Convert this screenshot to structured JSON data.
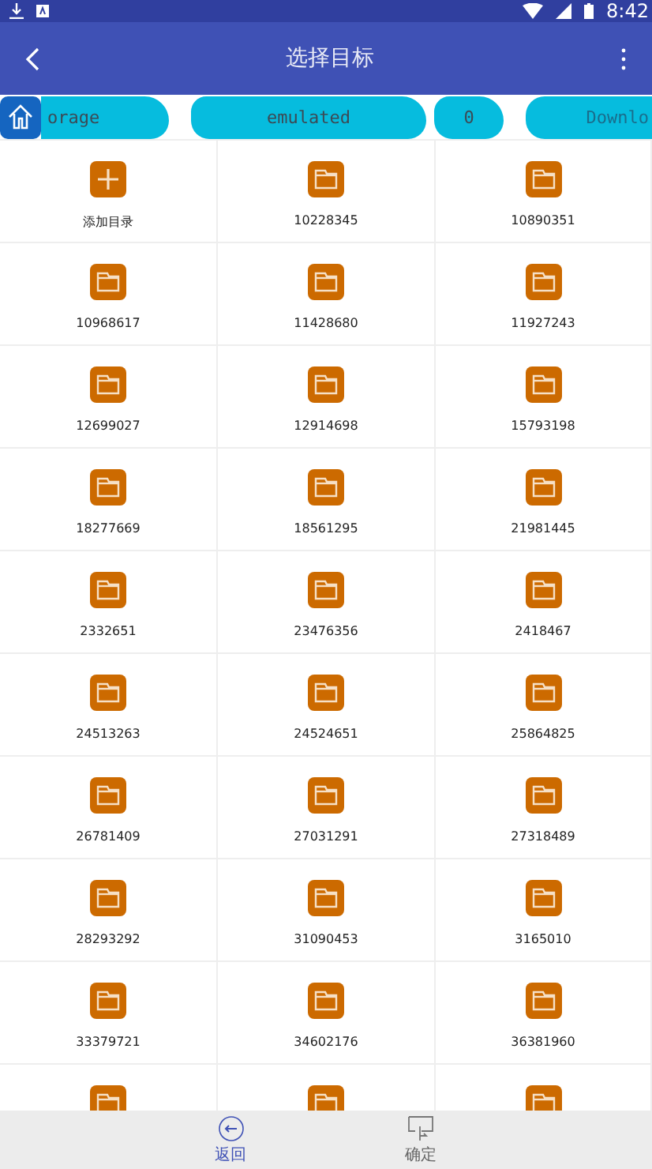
{
  "status_bar": {
    "time": "8:42"
  },
  "toolbar": {
    "title": "选择目标"
  },
  "breadcrumbs": [
    {
      "label": "orage",
      "dimmed": false
    },
    {
      "label": "emulated",
      "dimmed": false
    },
    {
      "label": "0",
      "dimmed": false
    },
    {
      "label": "Downlo",
      "dimmed": true
    }
  ],
  "grid": [
    {
      "kind": "add",
      "label": "添加目录"
    },
    {
      "kind": "folder",
      "label": "10228345"
    },
    {
      "kind": "folder",
      "label": "10890351"
    },
    {
      "kind": "folder",
      "label": "10968617"
    },
    {
      "kind": "folder",
      "label": "11428680"
    },
    {
      "kind": "folder",
      "label": "11927243"
    },
    {
      "kind": "folder",
      "label": "12699027"
    },
    {
      "kind": "folder",
      "label": "12914698"
    },
    {
      "kind": "folder",
      "label": "15793198"
    },
    {
      "kind": "folder",
      "label": "18277669"
    },
    {
      "kind": "folder",
      "label": "18561295"
    },
    {
      "kind": "folder",
      "label": "21981445"
    },
    {
      "kind": "folder",
      "label": "2332651"
    },
    {
      "kind": "folder",
      "label": "23476356"
    },
    {
      "kind": "folder",
      "label": "2418467"
    },
    {
      "kind": "folder",
      "label": "24513263"
    },
    {
      "kind": "folder",
      "label": "24524651"
    },
    {
      "kind": "folder",
      "label": "25864825"
    },
    {
      "kind": "folder",
      "label": "26781409"
    },
    {
      "kind": "folder",
      "label": "27031291"
    },
    {
      "kind": "folder",
      "label": "27318489"
    },
    {
      "kind": "folder",
      "label": "28293292"
    },
    {
      "kind": "folder",
      "label": "31090453"
    },
    {
      "kind": "folder",
      "label": "3165010"
    },
    {
      "kind": "folder",
      "label": "33379721"
    },
    {
      "kind": "folder",
      "label": "34602176"
    },
    {
      "kind": "folder",
      "label": "36381960"
    },
    {
      "kind": "folder"
    },
    {
      "kind": "folder"
    },
    {
      "kind": "folder"
    }
  ],
  "bottom_nav": [
    {
      "kind": "back",
      "label": "返回",
      "active": true
    },
    {
      "kind": "confirm",
      "label": "确定",
      "active": false
    }
  ]
}
